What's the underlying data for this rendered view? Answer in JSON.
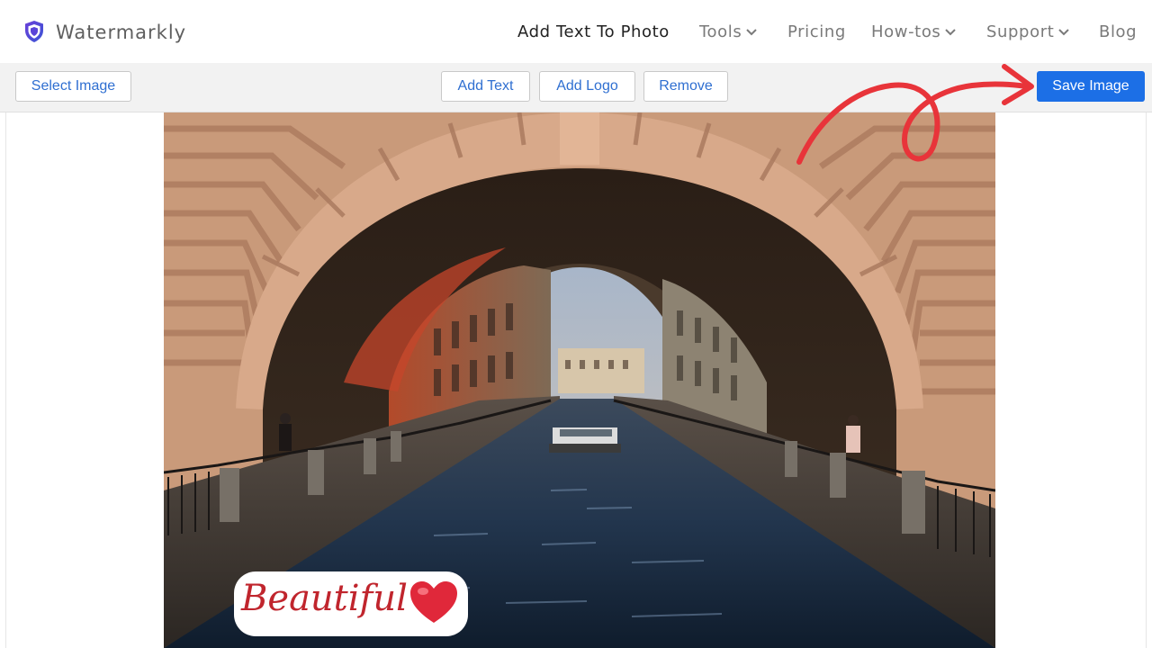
{
  "header": {
    "brand": "Watermarkly",
    "nav": [
      {
        "label": "Add Text To Photo",
        "has_dropdown": false,
        "active": true
      },
      {
        "label": "Tools",
        "has_dropdown": true
      },
      {
        "label": "Pricing",
        "has_dropdown": false
      },
      {
        "label": "How-tos",
        "has_dropdown": true
      },
      {
        "label": "Support",
        "has_dropdown": true
      },
      {
        "label": "Blog",
        "has_dropdown": false
      }
    ]
  },
  "toolbar": {
    "select_image": "Select Image",
    "add_text": "Add Text",
    "add_logo": "Add Logo",
    "remove": "Remove",
    "save_image": "Save Image"
  },
  "canvas": {
    "watermark_text": "Beautiful",
    "watermark_icon": "heart-icon",
    "photo_subject": "canal-under-stone-arch-photo"
  },
  "colors": {
    "primary": "#1c6fe6",
    "link": "#2f6fd1",
    "annotation_arrow": "#e8343a",
    "watermark_text": "#c0252d"
  }
}
